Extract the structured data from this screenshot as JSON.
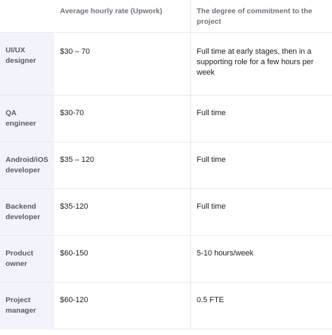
{
  "table": {
    "headers": {
      "corner": "",
      "rate": "Average hourly rate (Upwork)",
      "commitment": "The degree of commitment to the project"
    },
    "rows": [
      {
        "role": "UI/UX designer",
        "rate": "$30 – 70",
        "commitment": "Full time at early stages, then in a supporting role for a few hours per week"
      },
      {
        "role": "QA engineer",
        "rate": "$30-70",
        "commitment": "Full time"
      },
      {
        "role": "Android/iOS developer",
        "rate": "$35 – 120",
        "commitment": "Full time"
      },
      {
        "role": "Backend developer",
        "rate": "$35-120",
        "commitment": "Full time"
      },
      {
        "role": "Product owner",
        "rate": "$60-150",
        "commitment": "5-10 hours/week"
      },
      {
        "role": "Project manager",
        "rate": "$60-120",
        "commitment": "0.5 FTE"
      }
    ]
  }
}
